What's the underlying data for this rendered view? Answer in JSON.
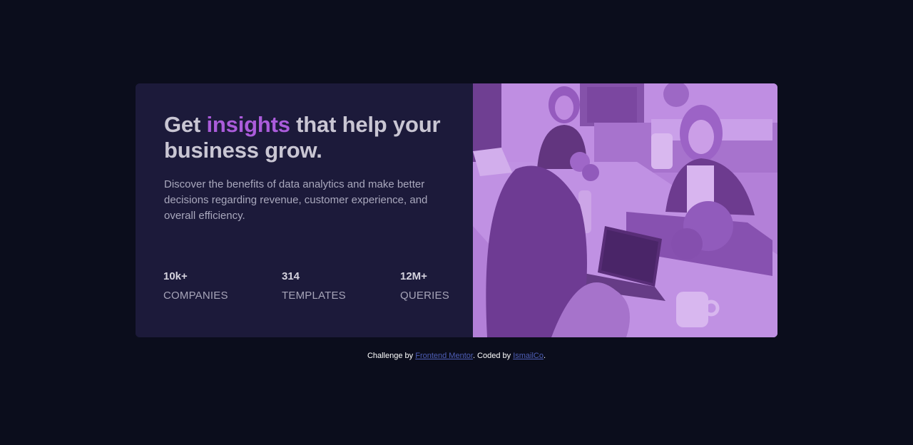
{
  "headline": {
    "part1": "Get ",
    "accent": "insights",
    "part2": " that help your business grow."
  },
  "description": "Discover the benefits of data analytics and make better decisions regarding revenue, customer experience, and overall efficiency.",
  "stats": [
    {
      "value": "10k+",
      "label": "COMPANIES"
    },
    {
      "value": "314",
      "label": "TEMPLATES"
    },
    {
      "value": "12M+",
      "label": "QUERIES"
    }
  ],
  "footer": {
    "prefix": "Challenge by ",
    "link1": "Frontend Mentor",
    "middle": ". Coded by ",
    "link2": "IsmailCo",
    "suffix": "."
  },
  "colors": {
    "page_bg": "#0b0d1c",
    "card_bg": "#1c1a3a",
    "accent": "#ab5cdb",
    "image_tint": "#8a57ad"
  },
  "image": {
    "description_icon": "office-team-photo"
  }
}
